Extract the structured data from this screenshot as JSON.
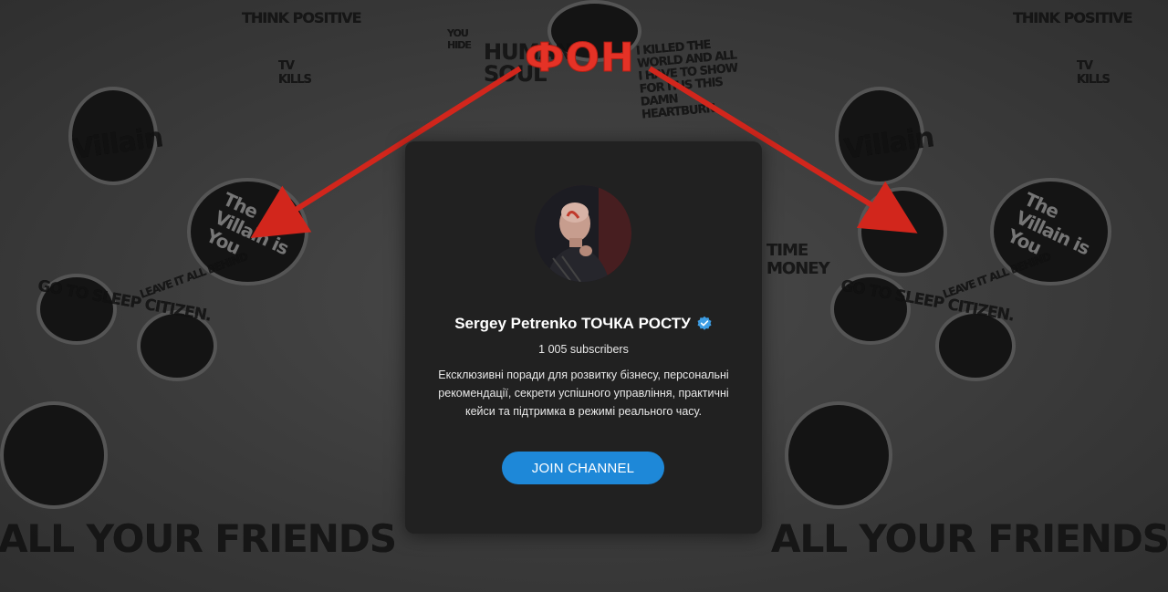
{
  "annotation": {
    "label": "ФОН",
    "color": "#e53226"
  },
  "background_decor": {
    "words": [
      "Villain",
      "THINK POSITIVE",
      "GO TO SLEEP CITIZEN.",
      "ALL YOUR FRIENDS",
      "LEAVE IT ALL BEHIND",
      "I KILLED THE WORLD AND ALL I HAVE TO SHOW FOR IT IS THIS DAMN HEARTBURN.",
      "HUMAN SOUL",
      "The Villain is You",
      "TV KILLS",
      "TIME MONEY",
      "YOU HIDE"
    ]
  },
  "channel": {
    "title": "Sergey Petrenko ТОЧКА РОСТУ",
    "verified_icon": "verified-badge-icon",
    "subscribers": "1 005 subscribers",
    "description": "Ексклюзивні поради для розвитку бізнесу, персональні рекомендації, секрети успішного управління, практичні кейси та підтримка в режимі реального часу.",
    "join_label": "JOIN CHANNEL",
    "accent_color": "#1e88d8"
  }
}
